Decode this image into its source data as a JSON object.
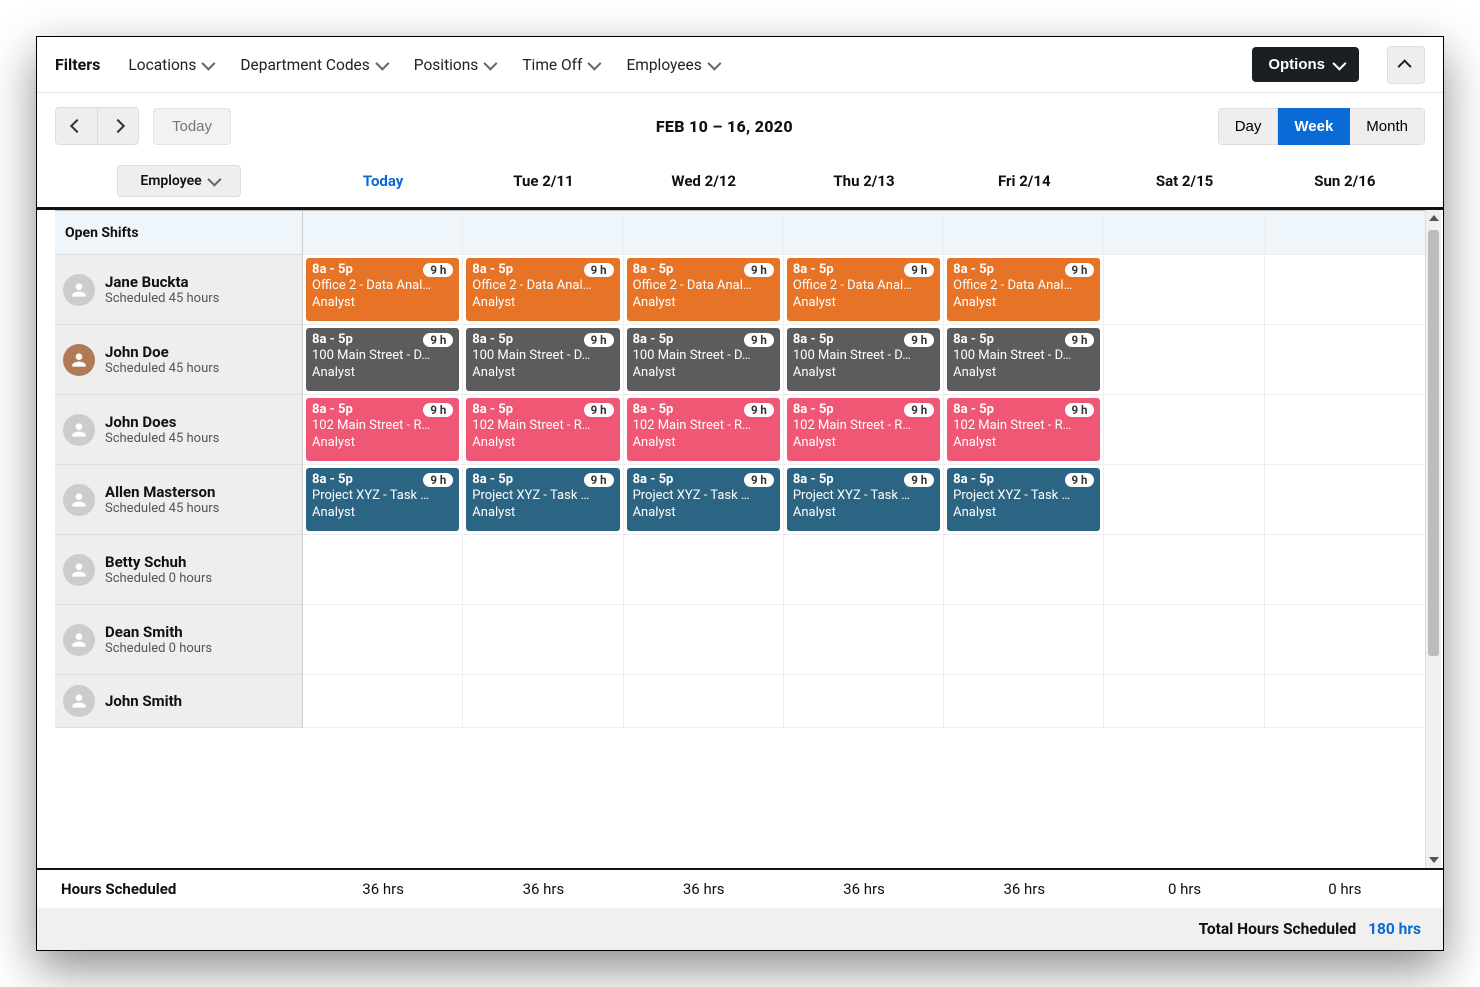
{
  "filters": {
    "label": "Filters",
    "items": [
      "Locations",
      "Department Codes",
      "Positions",
      "Time Off",
      "Employees"
    ]
  },
  "options_label": "Options",
  "nav": {
    "today_label": "Today",
    "date_range": "FEB 10 – 16, 2020",
    "views": {
      "day": "Day",
      "week": "Week",
      "month": "Month",
      "active": "week"
    }
  },
  "columns": {
    "employee_label": "Employee",
    "days": [
      {
        "label": "Today",
        "is_today": true
      },
      {
        "label": "Tue 2/11",
        "is_today": false
      },
      {
        "label": "Wed 2/12",
        "is_today": false
      },
      {
        "label": "Thu 2/13",
        "is_today": false
      },
      {
        "label": "Fri 2/14",
        "is_today": false
      },
      {
        "label": "Sat 2/15",
        "is_today": false
      },
      {
        "label": "Sun 2/16",
        "is_today": false
      }
    ]
  },
  "open_shifts_label": "Open Shifts",
  "shift_template": {
    "time": "8a - 5p",
    "badge": "9 h",
    "role": "Analyst"
  },
  "locations": {
    "orange": "Office 2 - Data Anal…",
    "gray": "100 Main Street - D…",
    "pink": "102 Main Street - R…",
    "teal": "Project XYZ - Task …"
  },
  "employees": [
    {
      "name": "Jane Buckta",
      "sub": "Scheduled 45 hours",
      "color": "orange",
      "shifts_days": 5,
      "photo": false
    },
    {
      "name": "John Doe",
      "sub": "Scheduled 45 hours",
      "color": "gray",
      "shifts_days": 5,
      "photo": true
    },
    {
      "name": "John Does",
      "sub": "Scheduled 45 hours",
      "color": "pink",
      "shifts_days": 5,
      "photo": false
    },
    {
      "name": "Allen Masterson",
      "sub": "Scheduled 45 hours",
      "color": "teal",
      "shifts_days": 5,
      "photo": false
    },
    {
      "name": "Betty Schuh",
      "sub": "Scheduled 0 hours",
      "color": null,
      "shifts_days": 0,
      "photo": false
    },
    {
      "name": "Dean Smith",
      "sub": "Scheduled 0 hours",
      "color": null,
      "shifts_days": 0,
      "photo": false
    },
    {
      "name": "John Smith",
      "sub": "",
      "color": null,
      "shifts_days": 0,
      "photo": false
    }
  ],
  "footer": {
    "label": "Hours Scheduled",
    "values": [
      "36 hrs",
      "36 hrs",
      "36 hrs",
      "36 hrs",
      "36 hrs",
      "0 hrs",
      "0 hrs"
    ],
    "total_label": "Total Hours Scheduled",
    "total_value": "180 hrs"
  }
}
